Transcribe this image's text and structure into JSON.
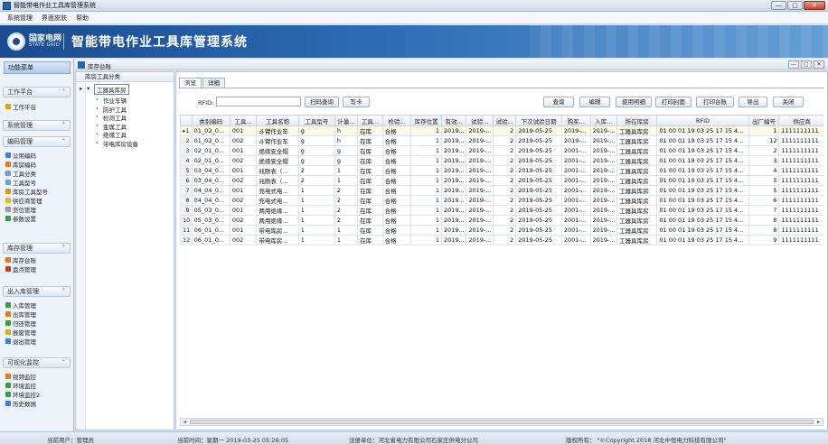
{
  "window": {
    "title": "智能带电作业工具库管理系统",
    "buttons": [
      "—",
      "▢",
      "✕"
    ]
  },
  "menu": [
    "系统管理",
    "界面皮肤",
    "帮助"
  ],
  "banner": {
    "logo_cn": "国家电网",
    "logo_en": "STATE GRID",
    "title": "智能带电作业工具库管理系统"
  },
  "sidebar": {
    "header": "功能菜单",
    "sections": [
      {
        "label": "工作平台",
        "items": [
          {
            "label": "工作平台",
            "icon": "star-icon",
            "color": "#e0a500"
          }
        ]
      },
      {
        "label": "系统管理",
        "items": []
      },
      {
        "label": "编码管理",
        "items": [
          {
            "label": "公用编码",
            "icon": "code-icon",
            "color": "#3d7fd1"
          },
          {
            "label": "库房编码",
            "icon": "warehouse-icon",
            "color": "#e07b20"
          },
          {
            "label": "工具分类",
            "icon": "category-icon",
            "color": "#6a9ed8"
          },
          {
            "label": "工具型号",
            "icon": "model-icon",
            "color": "#6a9ed8"
          },
          {
            "label": "库房工具型号",
            "icon": "tool-model-icon",
            "color": "#d49a1a"
          },
          {
            "label": "供应商管理",
            "icon": "supplier-icon",
            "color": "#e5b820"
          },
          {
            "label": "货位管理",
            "icon": "location-icon",
            "color": "#999999"
          },
          {
            "label": "参数设置",
            "icon": "settings-icon",
            "color": "#3b9a4a"
          }
        ]
      },
      {
        "label": "库存管理",
        "items": [
          {
            "label": "库存台账",
            "icon": "ledger-icon",
            "color": "#e07b20"
          },
          {
            "label": "盘点管理",
            "icon": "inventory-icon",
            "color": "#c0392b"
          }
        ]
      },
      {
        "label": "出入库管理",
        "items": [
          {
            "label": "入库管理",
            "icon": "inbound-icon",
            "color": "#3b9a4a"
          },
          {
            "label": "出库管理",
            "icon": "outbound-icon",
            "color": "#e07b20"
          },
          {
            "label": "归还管理",
            "icon": "return-icon",
            "color": "#3b9a4a"
          },
          {
            "label": "报废管理",
            "icon": "scrap-icon",
            "color": "#d4b020"
          },
          {
            "label": "退出管理",
            "icon": "exit-icon",
            "color": "#3d7fd1"
          }
        ]
      },
      {
        "label": "可视化监控",
        "items": [
          {
            "label": "视频监控",
            "icon": "video-icon",
            "color": "#e07b20"
          },
          {
            "label": "环境监控",
            "icon": "env-icon",
            "color": "#3b9a4a"
          },
          {
            "label": "环境监控2",
            "icon": "env2-icon",
            "color": "#3b9a4a"
          },
          {
            "label": "历史数据",
            "icon": "history-icon",
            "color": "#3d7fd1"
          }
        ]
      }
    ]
  },
  "inner_window": {
    "title": "库存台账",
    "buttons": [
      "—",
      "▢",
      "✕"
    ]
  },
  "tree": {
    "header": "库房工具分类",
    "root": "工器具库房",
    "children": [
      "作业车辆",
      "防护工具",
      "检测工具",
      "金属工具",
      "绝缘工具",
      "带电库房设备"
    ]
  },
  "tabs": [
    "浏览",
    "详细"
  ],
  "toolbar": {
    "rfid_label": "RFID:",
    "rfid_value": "",
    "scan_query": "扫码查询",
    "write_card": "写卡",
    "query": "查询",
    "edit": "编辑",
    "usage": "使用明细",
    "print_page": "打印封面",
    "print_ledger": "打印台账",
    "export": "导出",
    "close": "关闭"
  },
  "grid": {
    "columns": [
      "类别编码",
      "工具...",
      "工具名称",
      "工具型号",
      "计量...",
      "工具...",
      "检验...",
      "库存位置",
      "有效...",
      "试验...",
      "试验...",
      "下次试验日期",
      "购买...",
      "入库...",
      "所在库房",
      "RFID",
      "出厂编号",
      "供应商"
    ],
    "rows": [
      [
        "01_02_0...",
        "001",
        "斗臂作业车",
        "g",
        "h",
        "在库",
        "合格",
        "1",
        "2019...",
        "2019-...",
        "2",
        "2019-05-25",
        "2019-...",
        "2019-...",
        "工器具库房",
        "01 00 01 19 03 25 17 15 4...",
        "1",
        "1111111111"
      ],
      [
        "01_02_0...",
        "002",
        "斗臂作业车",
        "g",
        "h",
        "在库",
        "合格",
        "1",
        "2019...",
        "2019-...",
        "2",
        "2019-05-25",
        "2019-...",
        "2019-...",
        "工器具库房",
        "01 00 01 19 03 25 17 15 4...",
        "12",
        "1111111111"
      ],
      [
        "02_01_0...",
        "001",
        "绝缘安全帽",
        "g",
        "g",
        "在库",
        "合格",
        "1",
        "2019...",
        "2019-...",
        "2",
        "2019-05-25",
        "2001-...",
        "2019-...",
        "工器具库房",
        "01 00 01 19 03 25 17 15 4...",
        "2",
        "1111111111"
      ],
      [
        "02_01_0...",
        "002",
        "绝缘安全帽",
        "g",
        "g",
        "在库",
        "合格",
        "1",
        "2019...",
        "2019-...",
        "2",
        "2019-05-25",
        "2001-...",
        "2019-...",
        "工器具库房",
        "01 00 01 19 03 25 17 15 4...",
        "3",
        "1111111111"
      ],
      [
        "03_04_0...",
        "001",
        "兆欧表（...",
        "2",
        "1",
        "在库",
        "合格",
        "1",
        "2019...",
        "2019-...",
        "2",
        "2019-05-25",
        "2001-...",
        "2019-...",
        "工器具库房",
        "01 00 01 19 03 25 17 15 4...",
        "4",
        "1111111111"
      ],
      [
        "03_04_0...",
        "002",
        "兆欧表（...",
        "2",
        "1",
        "在库",
        "合格",
        "1",
        "2019...",
        "2019-...",
        "2",
        "2019-05-25",
        "2001-...",
        "2019-...",
        "工器具库房",
        "01 00 01 19 03 25 17 15 4...",
        "5",
        "1111111111"
      ],
      [
        "04_04_0...",
        "001",
        "充电式电...",
        "1",
        "2",
        "在库",
        "合格",
        "1",
        "2019...",
        "2019-...",
        "2",
        "2019-05-25",
        "2001-...",
        "2019-...",
        "工器具库房",
        "01 00 01 19 03 25 17 15 4...",
        "5",
        "1111111111"
      ],
      [
        "04_04_0...",
        "002",
        "充电式电...",
        "1",
        "2",
        "在库",
        "合格",
        "1",
        "2019...",
        "2019-...",
        "2",
        "2019-05-25",
        "2001-...",
        "2019-...",
        "工器具库房",
        "01 00 01 19 03 25 17 15 4...",
        "6",
        "1111111111"
      ],
      [
        "05_03_0...",
        "001",
        "两用绝缘...",
        "1",
        "2",
        "在库",
        "合格",
        "1",
        "2019...",
        "2019-...",
        "2",
        "2019-05-25",
        "2001-...",
        "2019-...",
        "工器具库房",
        "01 00 01 19 03 25 17 15 4...",
        "7",
        "1111111111"
      ],
      [
        "05_03_0...",
        "002",
        "两用绝缘...",
        "1",
        "2",
        "在库",
        "合格",
        "1",
        "2019...",
        "2019-...",
        "2",
        "2019-05-25",
        "2001-...",
        "2019-...",
        "工器具库房",
        "01 00 01 19 03 25 17 15 4...",
        "8",
        "1111111111"
      ],
      [
        "06_01_0...",
        "001",
        "带电库房...",
        "1",
        "1",
        "在库",
        "合格",
        "1",
        "2019...",
        "2019-...",
        "2",
        "2019-05-25",
        "2001-...",
        "2019-...",
        "工器具库房",
        "01 00 01 19 03 25 17 15 4...",
        "8",
        "1111111111"
      ],
      [
        "06_01_0...",
        "002",
        "带电库房...",
        "1",
        "1",
        "在库",
        "合格",
        "1",
        "2019...",
        "2019-...",
        "2",
        "2019-05-25",
        "2001-...",
        "2019-...",
        "工器具库房",
        "01 00 01 19 03 25 17 15 4...",
        "9",
        "1111111111"
      ]
    ],
    "selected_row": 0
  },
  "statusbar": {
    "user": "当前用户：管理员",
    "time": "当前时间：星期一  2019-03-25 05:26:05",
    "registered": "注册单位：河北省电力有限公司石家庄供电分公司",
    "copyright": "版权所有： \"©Copyright  2018  河北中恒电力科技有限公司\""
  }
}
